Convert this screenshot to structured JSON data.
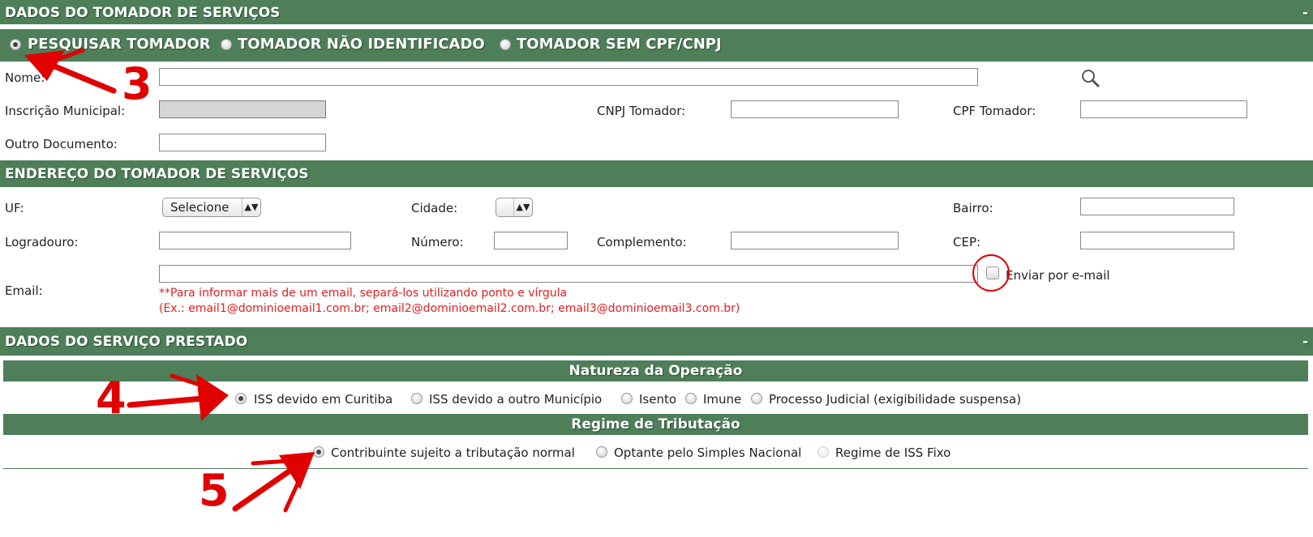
{
  "tomador": {
    "header": "DADOS DO TOMADOR DE SERVIÇOS",
    "collapse": "-",
    "mode_options": [
      "PESQUISAR TOMADOR",
      "TOMADOR NÃO IDENTIFICADO",
      "TOMADOR SEM CPF/CNPJ"
    ],
    "selected_mode": 0,
    "nome_label": "Nome:",
    "nome_value": "",
    "search_icon": "magnifier-icon",
    "inscricao_label": "Inscrição Municipal:",
    "cnpj_label": "CNPJ Tomador:",
    "cpf_label": "CPF Tomador:",
    "outro_label": "Outro Documento:"
  },
  "endereco": {
    "header": "ENDEREÇO DO TOMADOR DE SERVIÇOS",
    "uf_label": "UF:",
    "uf_value": "Selecione",
    "cidade_label": "Cidade:",
    "cidade_value": "",
    "bairro_label": "Bairro:",
    "logradouro_label": "Logradouro:",
    "numero_label": "Número:",
    "complemento_label": "Complemento:",
    "cep_label": "CEP:",
    "email_label": "Email:",
    "email_note_1": "**Para informar mais de um email, separá-los utilizando ponto e vírgula",
    "email_note_2": "(Ex.: email1@dominioemail1.com.br; email2@dominioemail2.com.br; email3@dominioemail3.com.br)",
    "enviar_label": "Enviar por e-mail"
  },
  "servico": {
    "header": "DADOS DO SERVIÇO PRESTADO",
    "collapse": "-",
    "natureza_title": "Natureza da Operação",
    "natureza_options": [
      "ISS devido em Curitiba",
      "ISS devido a outro Município",
      "Isento",
      "Imune",
      "Processo Judicial (exigibilidade suspensa)"
    ],
    "natureza_selected": 0,
    "regime_title": "Regime de Tributação",
    "regime_options": [
      "Contribuinte sujeito a tributação normal",
      "Optante pelo Simples Nacional",
      "Regime de ISS Fixo"
    ],
    "regime_selected": 0
  },
  "annotations": {
    "step_3": "3",
    "step_4": "4",
    "step_5": "5",
    "color": "#e00000"
  },
  "colors": {
    "header_bg": "#4e7f59",
    "note_red": "#e02020"
  }
}
